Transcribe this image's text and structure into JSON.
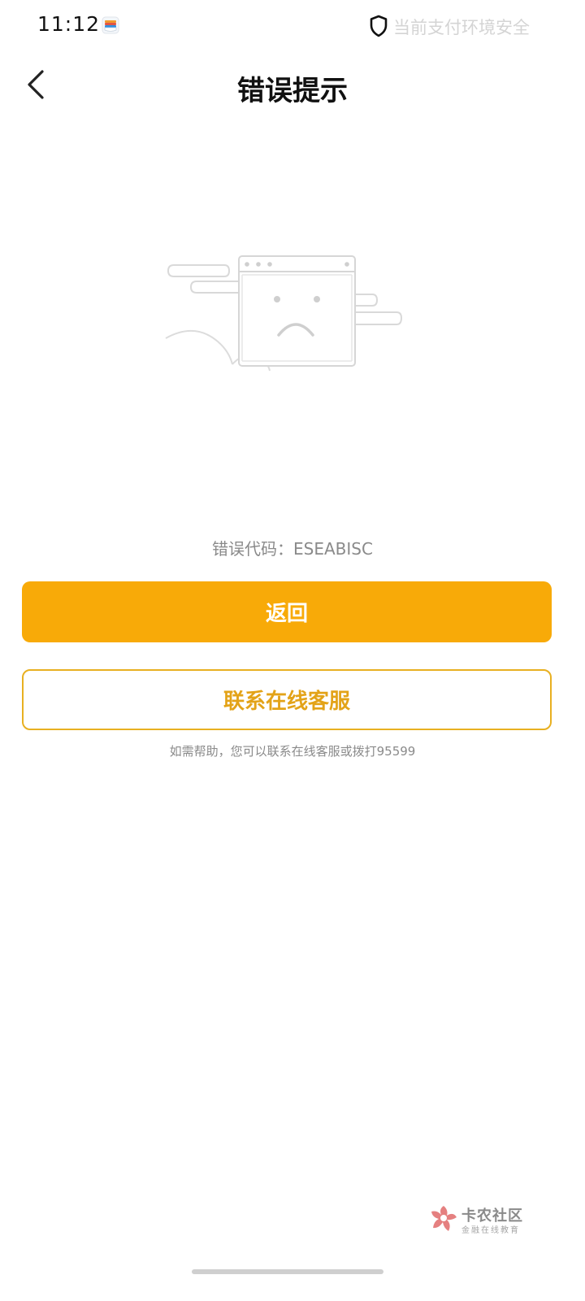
{
  "status_bar": {
    "time": "11:12",
    "app_icon": "wallet-app-icon",
    "secure_icon": "shield-icon",
    "secure_text": "当前支付环境安全"
  },
  "nav": {
    "back_icon": "chevron-left-icon",
    "title": "错误提示"
  },
  "illustration": {
    "icon": "sad-browser-window-illustration"
  },
  "error": {
    "label": "错误代码：",
    "code": "ESEABISC"
  },
  "actions": {
    "primary_label": "返回",
    "secondary_label": "联系在线客服"
  },
  "help_text": "如需帮助，您可以联系在线客服或拨打95599",
  "watermark": {
    "title": "卡农社区",
    "subtitle": "金融在线教育"
  },
  "colors": {
    "primary": "#f8aa08",
    "secondary_border": "#e8b021",
    "secondary_text": "#e3a318",
    "muted_text": "#8a8a8a"
  }
}
